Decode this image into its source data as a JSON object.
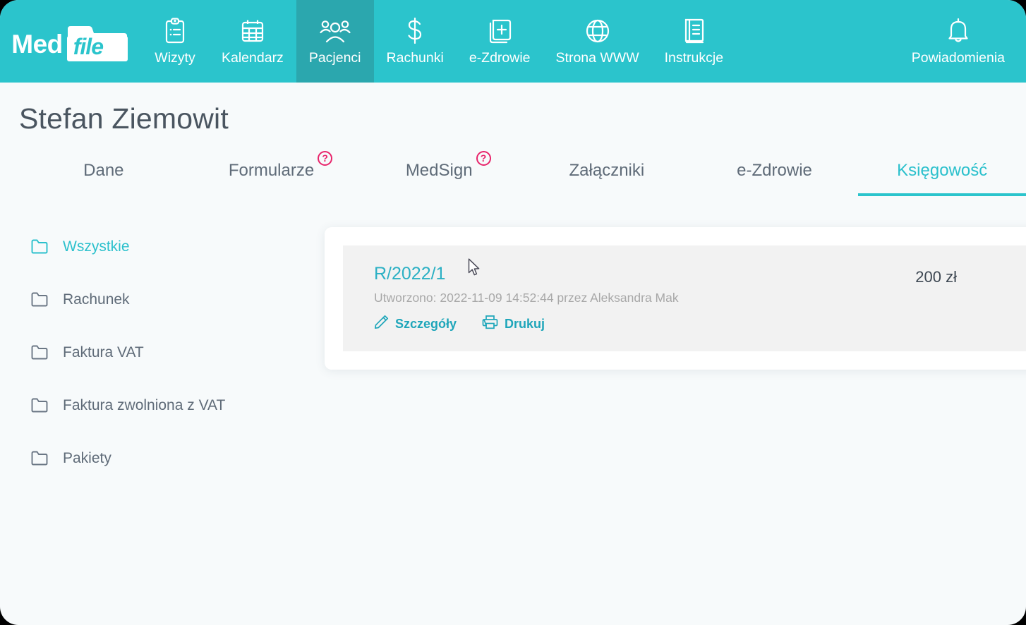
{
  "nav": {
    "logo": {
      "med": "Med",
      "file": "file"
    },
    "items": [
      {
        "label": "Wizyty",
        "icon": "clipboard-icon",
        "active": false
      },
      {
        "label": "Kalendarz",
        "icon": "calendar-icon",
        "active": false
      },
      {
        "label": "Pacjenci",
        "icon": "people-icon",
        "active": true
      },
      {
        "label": "Rachunki",
        "icon": "dollar-icon",
        "active": false
      },
      {
        "label": "e-Zdrowie",
        "icon": "medical-card-icon",
        "active": false
      },
      {
        "label": "Strona WWW",
        "icon": "globe-icon",
        "active": false
      },
      {
        "label": "Instrukcje",
        "icon": "book-icon",
        "active": false
      }
    ],
    "notifications": {
      "label": "Powiadomienia",
      "icon": "bell-icon"
    }
  },
  "page": {
    "patient_name": "Stefan Ziemowit"
  },
  "tabs": [
    {
      "label": "Dane",
      "active": false,
      "help": false
    },
    {
      "label": "Formularze",
      "active": false,
      "help": true,
      "help_glyph": "?"
    },
    {
      "label": "MedSign",
      "active": false,
      "help": true,
      "help_glyph": "?"
    },
    {
      "label": "Załączniki",
      "active": false,
      "help": false
    },
    {
      "label": "e-Zdrowie",
      "active": false,
      "help": false
    },
    {
      "label": "Księgowość",
      "active": true,
      "help": false
    }
  ],
  "folders": [
    {
      "label": "Wszystkie",
      "active": true
    },
    {
      "label": "Rachunek",
      "active": false
    },
    {
      "label": "Faktura VAT",
      "active": false
    },
    {
      "label": "Faktura zwolniona z VAT",
      "active": false
    },
    {
      "label": "Pakiety",
      "active": false
    }
  ],
  "invoices": [
    {
      "number": "R/2022/1",
      "meta": "Utworzono: 2022-11-09 14:52:44 przez Aleksandra Mak",
      "amount": "200 zł",
      "actions": [
        {
          "label": "Szczegóły",
          "icon": "pencil-icon"
        },
        {
          "label": "Drukuj",
          "icon": "printer-icon"
        }
      ]
    }
  ],
  "colors": {
    "brand_teal": "#2bc4cc",
    "brand_teal_active": "#2ba7ae",
    "link_teal": "#1fa6ba",
    "help_pink": "#e8246b",
    "page_bg": "#f7fafb",
    "text_gray": "#5f6b78"
  }
}
